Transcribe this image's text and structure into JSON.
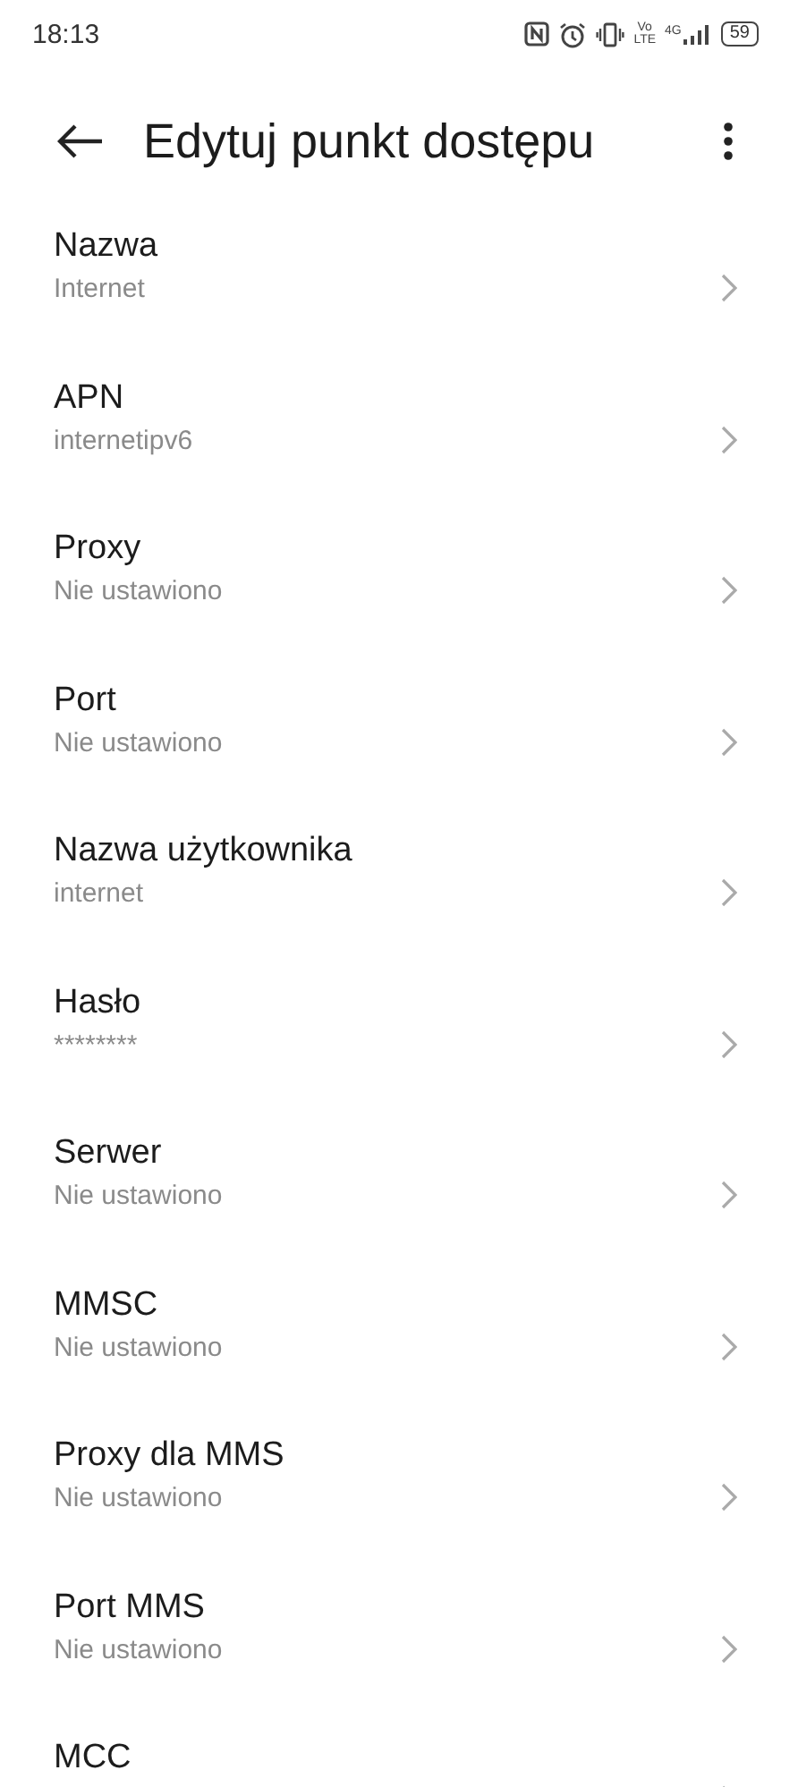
{
  "status_bar": {
    "time": "18:13",
    "volte": "Vo\nLTE",
    "network": "4G",
    "battery": "59"
  },
  "header": {
    "title": "Edytuj punkt dostępu"
  },
  "settings": [
    {
      "title": "Nazwa",
      "value": "Internet"
    },
    {
      "title": "APN",
      "value": "internetipv6"
    },
    {
      "title": "Proxy",
      "value": "Nie ustawiono"
    },
    {
      "title": "Port",
      "value": "Nie ustawiono"
    },
    {
      "title": "Nazwa użytkownika",
      "value": "internet"
    },
    {
      "title": "Hasło",
      "value": "********"
    },
    {
      "title": "Serwer",
      "value": "Nie ustawiono"
    },
    {
      "title": "MMSC",
      "value": "Nie ustawiono"
    },
    {
      "title": "Proxy dla MMS",
      "value": "Nie ustawiono"
    },
    {
      "title": "Port MMS",
      "value": "Nie ustawiono"
    },
    {
      "title": "MCC"
    }
  ]
}
